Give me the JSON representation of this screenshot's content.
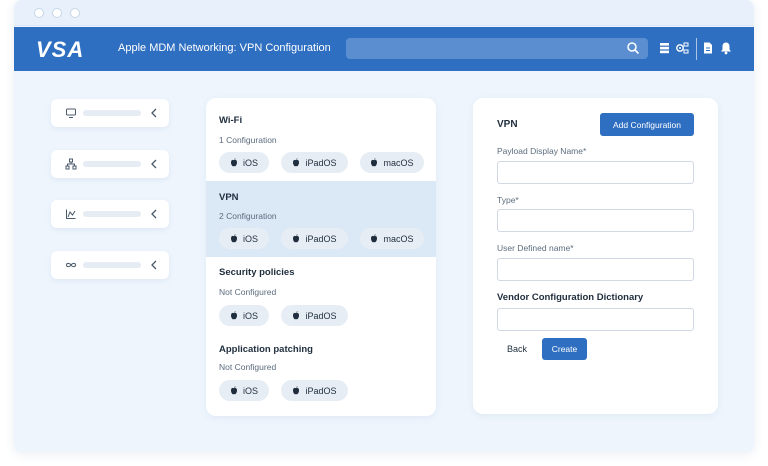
{
  "app": {
    "logo_text": "VSA",
    "title": "Apple MDM Networking: VPN Configuration"
  },
  "search": {
    "placeholder": ""
  },
  "sidebar": {
    "items": [
      {
        "icon": "monitor-icon"
      },
      {
        "icon": "network-icon"
      },
      {
        "icon": "chart-icon"
      },
      {
        "icon": "infinity-icon"
      }
    ]
  },
  "config_list": {
    "sections": [
      {
        "title": "Wi-Fi",
        "subtitle": "1 Configuration",
        "active": false,
        "platforms": [
          "iOS",
          "iPadOS",
          "macOS"
        ]
      },
      {
        "title": "VPN",
        "subtitle": "2 Configuration",
        "active": true,
        "platforms": [
          "iOS",
          "iPadOS",
          "macOS"
        ]
      },
      {
        "title": "Security policies",
        "subtitle": "Not Configured",
        "active": false,
        "platforms": [
          "iOS",
          "iPadOS"
        ]
      },
      {
        "title": "Application patching",
        "subtitle": "Not Configured",
        "active": false,
        "platforms": [
          "iOS",
          "iPadOS"
        ]
      }
    ]
  },
  "vpn_form": {
    "title": "VPN",
    "add_button": "Add Configuration",
    "payload_label": "Payload Display Name*",
    "payload_value": "",
    "type_label": "Type*",
    "type_value": "",
    "user_defined_label": "User Defined name*",
    "user_defined_value": "",
    "vendor_heading": "Vendor Configuration Dictionary",
    "vendor_value": "",
    "back_button": "Back",
    "create_button": "Create"
  },
  "colors": {
    "brand_blue": "#2f6fc1",
    "active_section": "#dbe8f6",
    "background": "#eef5fd"
  }
}
